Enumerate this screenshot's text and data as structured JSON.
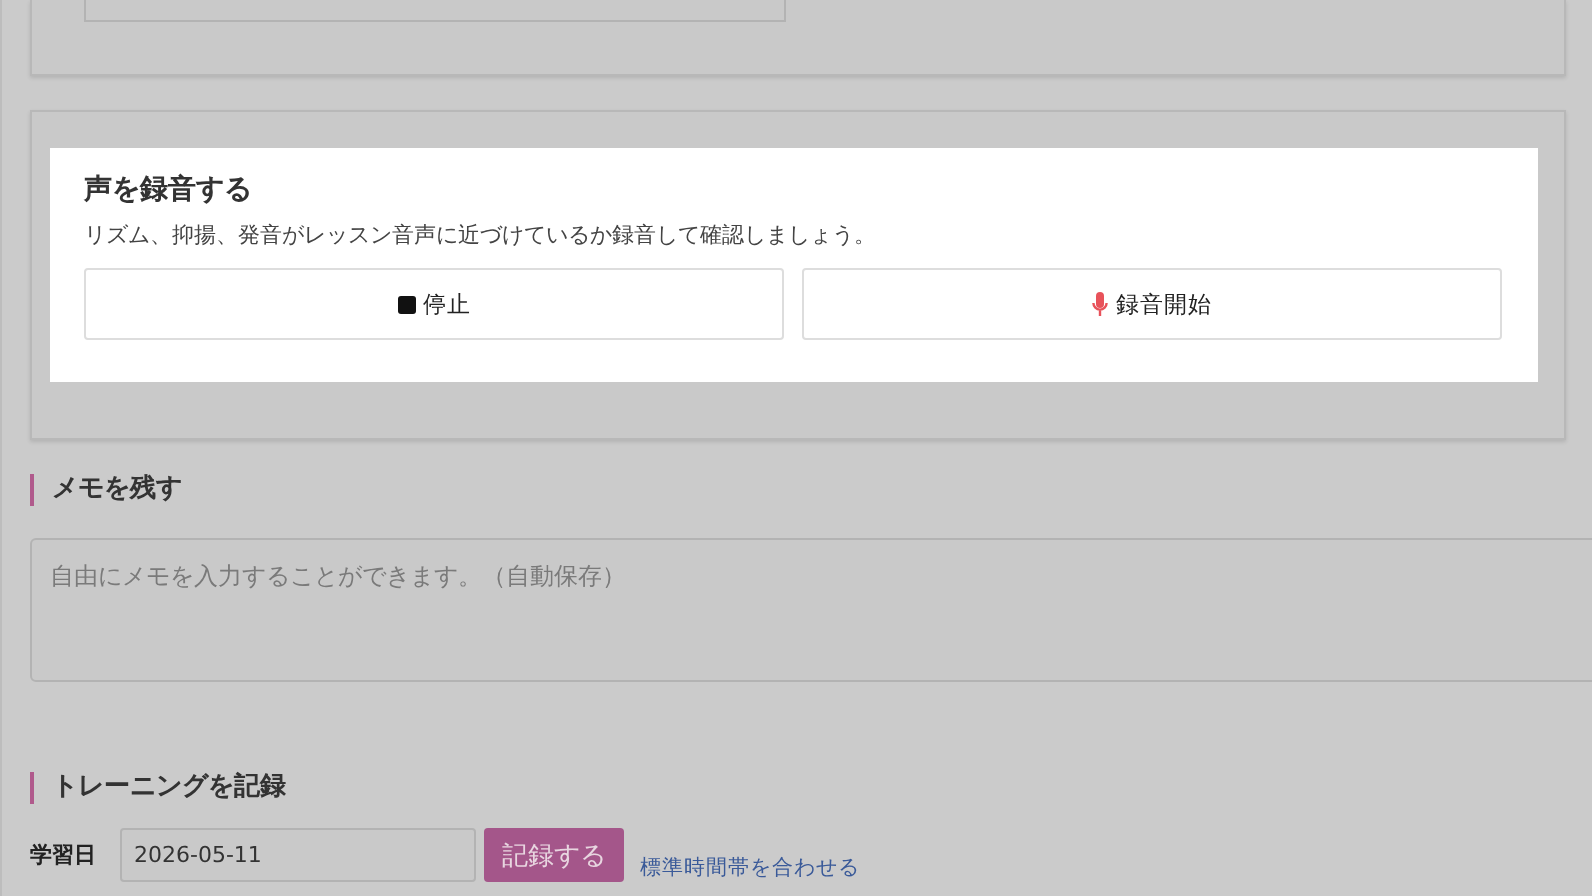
{
  "record_voice": {
    "title": "声を録音する",
    "description": "リズム、抑揚、発音がレッスン音声に近づけているか録音して確認しましょう。",
    "buttons": [
      {
        "kind": "stop",
        "label": "停止"
      },
      {
        "kind": "record",
        "label": "録音開始"
      }
    ]
  },
  "memo": {
    "heading": "メモを残す",
    "placeholder": "自由にメモを入力することができます。（自動保存）"
  },
  "training": {
    "heading": "トレーニングを記録",
    "date_label": "学習日",
    "date_value": "2026-05-11",
    "submit": "記録する",
    "timezone_link": "標準時間帯を合わせる"
  }
}
